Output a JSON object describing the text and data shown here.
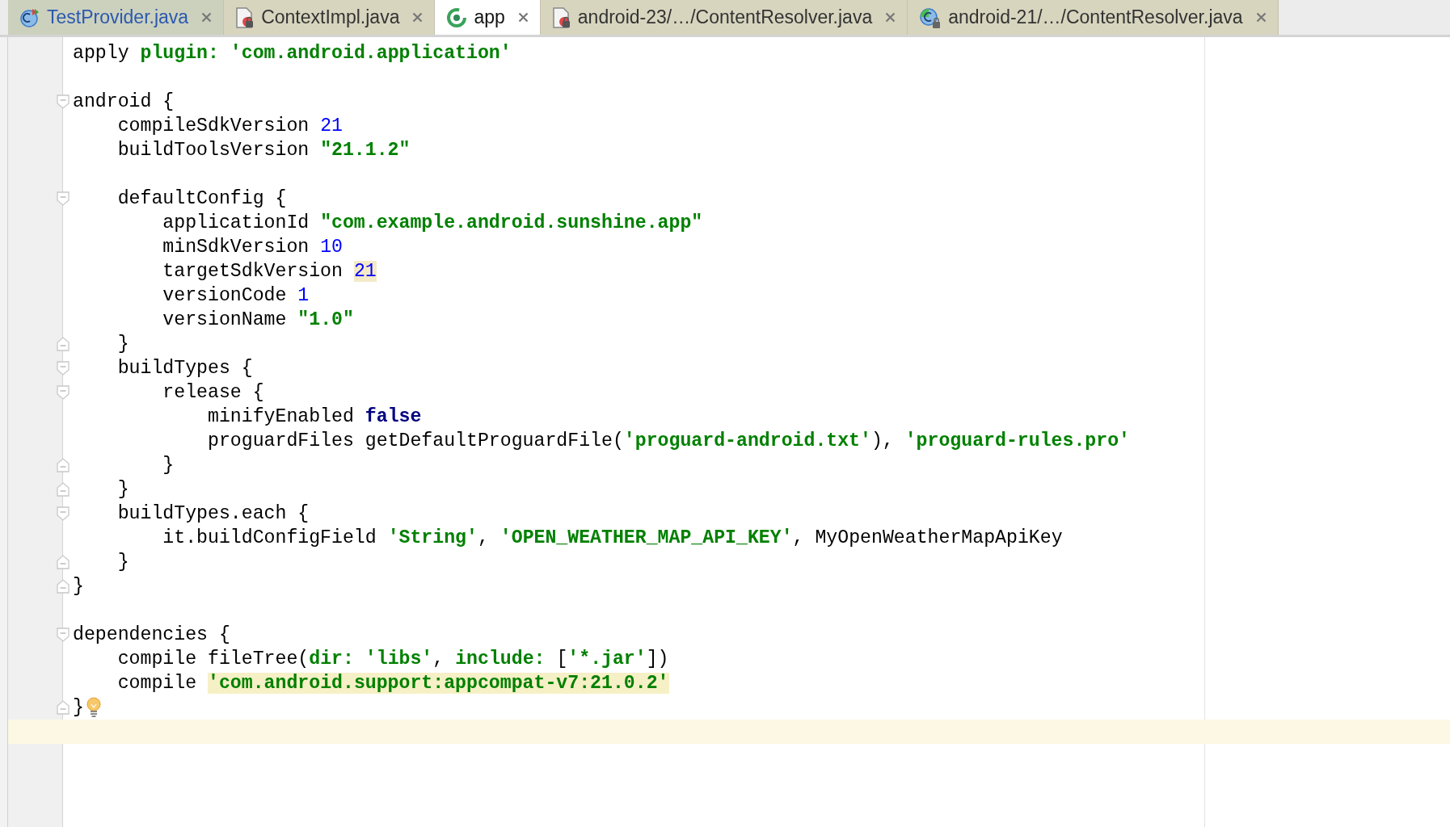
{
  "tabs": [
    {
      "label": "TestProvider.java",
      "kind": "class",
      "selected": false,
      "color": "#2c58b0"
    },
    {
      "label": "ContextImpl.java",
      "kind": "locked-file",
      "selected": false,
      "color": "#333333"
    },
    {
      "label": "app",
      "kind": "gradle",
      "selected": true,
      "color": "#111111"
    },
    {
      "label": "android-23/…/ContentResolver.java",
      "kind": "locked-file",
      "selected": false,
      "color": "#333333"
    },
    {
      "label": "android-21/…/ContentResolver.java",
      "kind": "locked-class",
      "selected": false,
      "color": "#333333"
    }
  ],
  "editor": {
    "lines": [
      {
        "kind": "plain",
        "segments": [
          {
            "kind": "text",
            "text": "apply "
          },
          {
            "kind": "label",
            "text": "plugin: "
          },
          {
            "kind": "string",
            "text": "'com.android.application'"
          }
        ]
      },
      {
        "kind": "plain"
      },
      {
        "kind": "fold-start",
        "segments": [
          {
            "kind": "text",
            "text": "android {"
          }
        ]
      },
      {
        "kind": "plain",
        "segments": [
          {
            "kind": "text",
            "text": "    compileSdkVersion "
          },
          {
            "kind": "number",
            "text": "21"
          }
        ]
      },
      {
        "kind": "plain",
        "segments": [
          {
            "kind": "text",
            "text": "    buildToolsVersion "
          },
          {
            "kind": "string",
            "text": "\"21.1.2\""
          }
        ]
      },
      {
        "kind": "plain"
      },
      {
        "kind": "fold-start",
        "segments": [
          {
            "kind": "text",
            "text": "    defaultConfig {"
          }
        ]
      },
      {
        "kind": "plain",
        "segments": [
          {
            "kind": "text",
            "text": "        applicationId "
          },
          {
            "kind": "string",
            "text": "\"com.example.android.sunshine.app\""
          }
        ]
      },
      {
        "kind": "plain",
        "segments": [
          {
            "kind": "text",
            "text": "        minSdkVersion "
          },
          {
            "kind": "number",
            "text": "10"
          }
        ]
      },
      {
        "kind": "plain",
        "segments": [
          {
            "kind": "text",
            "text": "        targetSdkVersion "
          },
          {
            "kind": "number",
            "text": "21",
            "highlight": true
          }
        ]
      },
      {
        "kind": "plain",
        "segments": [
          {
            "kind": "text",
            "text": "        versionCode "
          },
          {
            "kind": "number",
            "text": "1"
          }
        ]
      },
      {
        "kind": "plain",
        "segments": [
          {
            "kind": "text",
            "text": "        versionName "
          },
          {
            "kind": "string",
            "text": "\"1.0\""
          }
        ]
      },
      {
        "kind": "fold-end",
        "segments": [
          {
            "kind": "text",
            "text": "    }"
          }
        ]
      },
      {
        "kind": "fold-start",
        "segments": [
          {
            "kind": "text",
            "text": "    buildTypes {"
          }
        ]
      },
      {
        "kind": "fold-start",
        "segments": [
          {
            "kind": "text",
            "text": "        release {"
          }
        ]
      },
      {
        "kind": "plain",
        "segments": [
          {
            "kind": "text",
            "text": "            minifyEnabled "
          },
          {
            "kind": "keyword",
            "text": "false"
          }
        ]
      },
      {
        "kind": "plain",
        "segments": [
          {
            "kind": "text",
            "text": "            proguardFiles getDefaultProguardFile("
          },
          {
            "kind": "string",
            "text": "'proguard-android.txt'"
          },
          {
            "kind": "text",
            "text": "), "
          },
          {
            "kind": "string",
            "text": "'proguard-rules.pro'"
          }
        ]
      },
      {
        "kind": "fold-end",
        "segments": [
          {
            "kind": "text",
            "text": "        }"
          }
        ]
      },
      {
        "kind": "fold-end",
        "segments": [
          {
            "kind": "text",
            "text": "    }"
          }
        ]
      },
      {
        "kind": "fold-start",
        "segments": [
          {
            "kind": "text",
            "text": "    buildTypes.each {"
          }
        ]
      },
      {
        "kind": "plain",
        "segments": [
          {
            "kind": "text",
            "text": "        it.buildConfigField "
          },
          {
            "kind": "string",
            "text": "'String'"
          },
          {
            "kind": "text",
            "text": ", "
          },
          {
            "kind": "string",
            "text": "'OPEN_WEATHER_MAP_API_KEY'"
          },
          {
            "kind": "text",
            "text": ", MyOpenWeatherMapApiKey"
          }
        ]
      },
      {
        "kind": "fold-end",
        "segments": [
          {
            "kind": "text",
            "text": "    }"
          }
        ]
      },
      {
        "kind": "fold-end",
        "segments": [
          {
            "kind": "text",
            "text": "}"
          }
        ]
      },
      {
        "kind": "plain"
      },
      {
        "kind": "fold-start",
        "segments": [
          {
            "kind": "text",
            "text": "dependencies {"
          }
        ]
      },
      {
        "kind": "plain",
        "segments": [
          {
            "kind": "text",
            "text": "    compile fileTree("
          },
          {
            "kind": "label",
            "text": "dir: "
          },
          {
            "kind": "string",
            "text": "'libs'"
          },
          {
            "kind": "text",
            "text": ", "
          },
          {
            "kind": "label",
            "text": "include: "
          },
          {
            "kind": "text",
            "text": "["
          },
          {
            "kind": "string",
            "text": "'*.jar'"
          },
          {
            "kind": "text",
            "text": "])"
          }
        ]
      },
      {
        "kind": "plain",
        "segments": [
          {
            "kind": "text",
            "text": "    compile "
          },
          {
            "kind": "string",
            "text": "'com.android.support:appcompat-v7:21.0.2'",
            "highlight": true
          }
        ]
      },
      {
        "kind": "fold-end",
        "bulb": true,
        "segments": [
          {
            "kind": "text",
            "text": "}"
          }
        ]
      },
      {
        "kind": "plain",
        "current": true
      }
    ]
  }
}
